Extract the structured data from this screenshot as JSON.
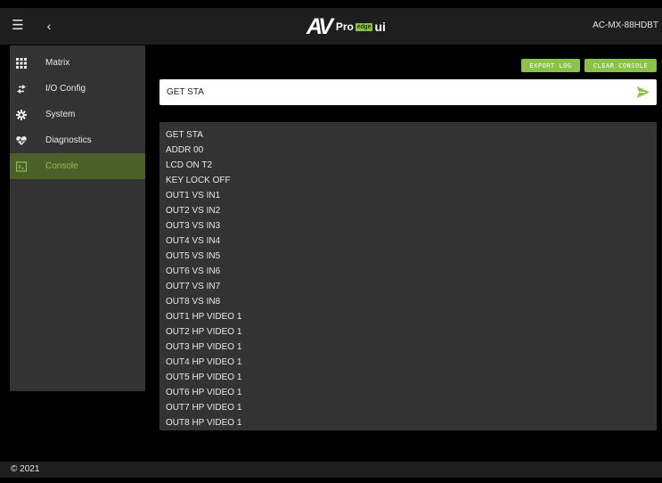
{
  "header": {
    "logo_av": "AV",
    "logo_pro": "Pro",
    "logo_badge": "edge",
    "logo_ui": "ui",
    "device_name": "AC-MX-88HDBT"
  },
  "sidebar": {
    "items": [
      {
        "label": "Matrix",
        "icon": "grid-icon"
      },
      {
        "label": "I/O Config",
        "icon": "swap-arrows-icon"
      },
      {
        "label": "System",
        "icon": "gear-icon"
      },
      {
        "label": "Diagnostics",
        "icon": "heartbeat-icon"
      },
      {
        "label": "Console",
        "icon": "terminal-icon",
        "active": true
      }
    ]
  },
  "toolbar": {
    "export_label": "EXPORT LOG",
    "clear_label": "CLEAR CONSOLE"
  },
  "command": {
    "value": "GET STA"
  },
  "console": {
    "lines": [
      "GET STA",
      "ADDR 00",
      "LCD ON T2",
      "KEY LOCK OFF",
      "OUT1 VS IN1",
      "OUT2 VS IN2",
      "OUT3 VS IN3",
      "OUT4 VS IN4",
      "OUT5 VS IN5",
      "OUT6 VS IN6",
      "OUT7 VS IN7",
      "OUT8 VS IN8",
      "OUT1 HP VIDEO 1",
      "OUT2 HP VIDEO 1",
      "OUT3 HP VIDEO 1",
      "OUT4 HP VIDEO 1",
      "OUT5 HP VIDEO 1",
      "OUT6 HP VIDEO 1",
      "OUT7 HP VIDEO 1",
      "OUT8 HP VIDEO 1"
    ]
  },
  "footer": {
    "copyright": "© 2021"
  },
  "colors": {
    "accent": "#8bc34a",
    "active_bg": "#4d5f29",
    "panel_bg": "#333333",
    "bar_bg": "#1e1e1e"
  }
}
